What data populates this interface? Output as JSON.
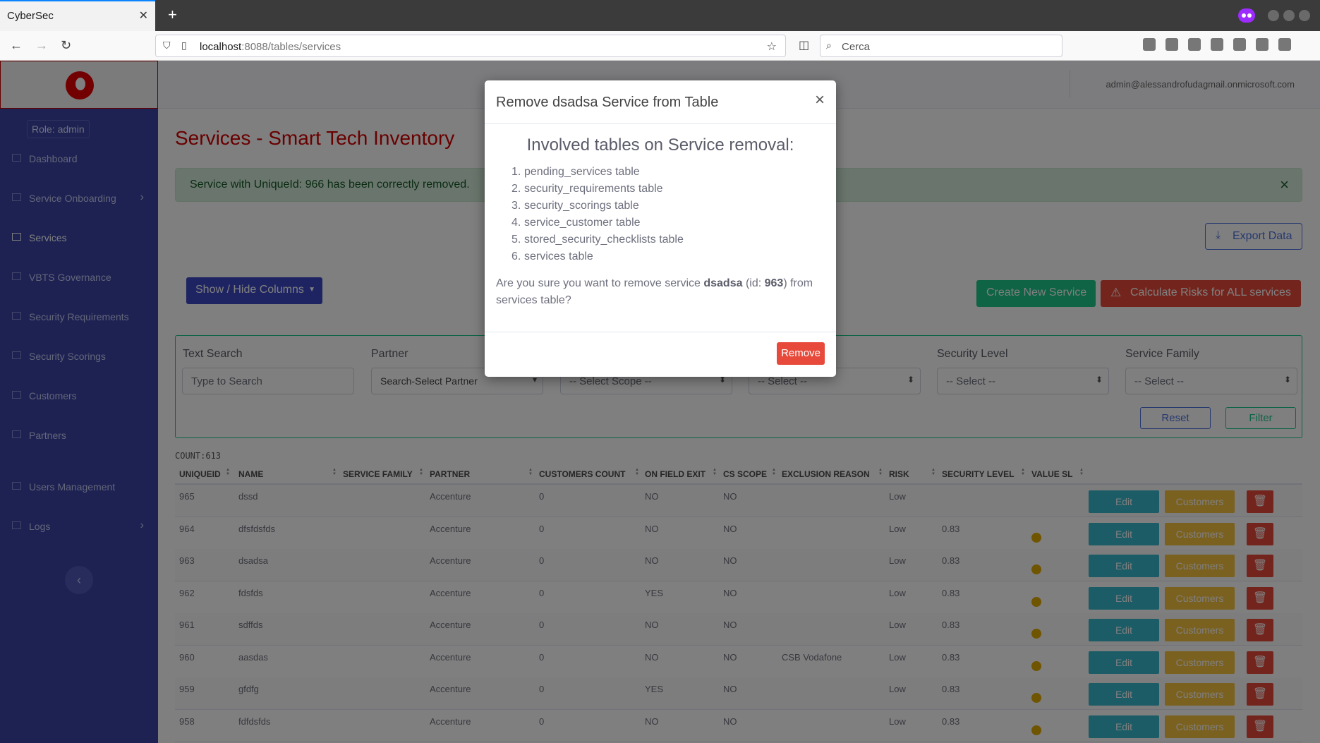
{
  "browser": {
    "tab_title": "CyberSec",
    "url_host": "localhost",
    "url_rest": ":8088/tables/services",
    "search_placeholder": "Cerca"
  },
  "sidebar": {
    "role": "Role: admin",
    "items": [
      {
        "label": "Dashboard",
        "icon": "table-icon",
        "chevron": false
      },
      {
        "label": "Service Onboarding",
        "icon": "table-icon",
        "chevron": true
      },
      {
        "label": "Services",
        "icon": "table-icon",
        "chevron": false,
        "active": true
      },
      {
        "label": "VBTS Governance",
        "icon": "table-icon",
        "chevron": false
      },
      {
        "label": "Security Requirements",
        "icon": "table-icon",
        "chevron": false
      },
      {
        "label": "Security Scorings",
        "icon": "table-icon",
        "chevron": false
      },
      {
        "label": "Customers",
        "icon": "table-icon",
        "chevron": false
      },
      {
        "label": "Partners",
        "icon": "table-icon",
        "chevron": false
      },
      {
        "label": "Users Management",
        "icon": "users-icon",
        "chevron": false
      },
      {
        "label": "Logs",
        "icon": "wrench-icon",
        "chevron": true
      }
    ]
  },
  "header": {
    "user_email": "admin@alessandrofudagmail.onmicrosoft.com"
  },
  "main": {
    "title": "Services - Smart Tech Inventory",
    "alert": "Service with UniqueId: 966 has been correctly removed.",
    "export_label": "Export Data",
    "show_hide_label": "Show / Hide Columns",
    "create_label": "Create New Service",
    "risk_label": "Calculate Risks for ALL services",
    "count": "COUNT:613"
  },
  "filters": {
    "text_search_label": "Text Search",
    "text_search_placeholder": "Type to Search",
    "partner_label": "Partner",
    "partner_value": "Search-Select Partner",
    "scope_value": "-- Select Scope --",
    "col4_value": "-- Select --",
    "security_level_label": "Security Level",
    "security_level_value": "-- Select --",
    "service_family_label": "Service Family",
    "service_family_value": "-- Select --",
    "reset_label": "Reset",
    "filter_label": "Filter"
  },
  "table": {
    "headers": [
      "UNIQUEID",
      "NAME",
      "SERVICE FAMILY",
      "PARTNER",
      "CUSTOMERS COUNT",
      "ON FIELD EXIT",
      "CS SCOPE",
      "EXCLUSION REASON",
      "RISK",
      "SECURITY LEVEL",
      "VALUE SL"
    ],
    "edit_label": "Edit",
    "customers_label": "Customers",
    "rows": [
      {
        "id": "965",
        "name": "dssd",
        "family": "",
        "partner": "Accenture",
        "count": "0",
        "exit": "NO",
        "scope": "NO",
        "reason": "",
        "risk": "Low",
        "sl": "",
        "dot": false
      },
      {
        "id": "964",
        "name": "dfsfdsfds",
        "family": "",
        "partner": "Accenture",
        "count": "0",
        "exit": "NO",
        "scope": "NO",
        "reason": "",
        "risk": "Low",
        "sl": "0.83",
        "dot": true
      },
      {
        "id": "963",
        "name": "dsadsa",
        "family": "",
        "partner": "Accenture",
        "count": "0",
        "exit": "NO",
        "scope": "NO",
        "reason": "",
        "risk": "Low",
        "sl": "0.83",
        "dot": true
      },
      {
        "id": "962",
        "name": "fdsfds",
        "family": "",
        "partner": "Accenture",
        "count": "0",
        "exit": "YES",
        "scope": "NO",
        "reason": "",
        "risk": "Low",
        "sl": "0.83",
        "dot": true
      },
      {
        "id": "961",
        "name": "sdffds",
        "family": "",
        "partner": "Accenture",
        "count": "0",
        "exit": "NO",
        "scope": "NO",
        "reason": "",
        "risk": "Low",
        "sl": "0.83",
        "dot": true
      },
      {
        "id": "960",
        "name": "aasdas",
        "family": "",
        "partner": "Accenture",
        "count": "0",
        "exit": "NO",
        "scope": "NO",
        "reason": "CSB Vodafone",
        "risk": "Low",
        "sl": "0.83",
        "dot": true
      },
      {
        "id": "959",
        "name": "gfdfg",
        "family": "",
        "partner": "Accenture",
        "count": "0",
        "exit": "YES",
        "scope": "NO",
        "reason": "",
        "risk": "Low",
        "sl": "0.83",
        "dot": true
      },
      {
        "id": "958",
        "name": "fdfdsfds",
        "family": "",
        "partner": "Accenture",
        "count": "0",
        "exit": "NO",
        "scope": "NO",
        "reason": "",
        "risk": "Low",
        "sl": "0.83",
        "dot": true
      }
    ]
  },
  "modal": {
    "title": "Remove dsadsa Service from Table",
    "subtitle": "Involved tables on Service removal:",
    "tables": [
      "pending_services table",
      "security_requirements table",
      "security_scorings table",
      "service_customer table",
      "stored_security_checklists table",
      "services table"
    ],
    "question_pre": "Are you sure you want to remove service ",
    "service_name": "dsadsa",
    "question_mid": " (id: ",
    "service_id": "963",
    "question_post": ") from services table?",
    "remove_label": "Remove",
    "close_label": "×"
  },
  "colors": {
    "sidebar": "#3b44a5",
    "title": "#d20000",
    "success": "#1cc88a",
    "danger": "#e74a3b",
    "info": "#36b9cc",
    "warning": "#f6c23e"
  }
}
